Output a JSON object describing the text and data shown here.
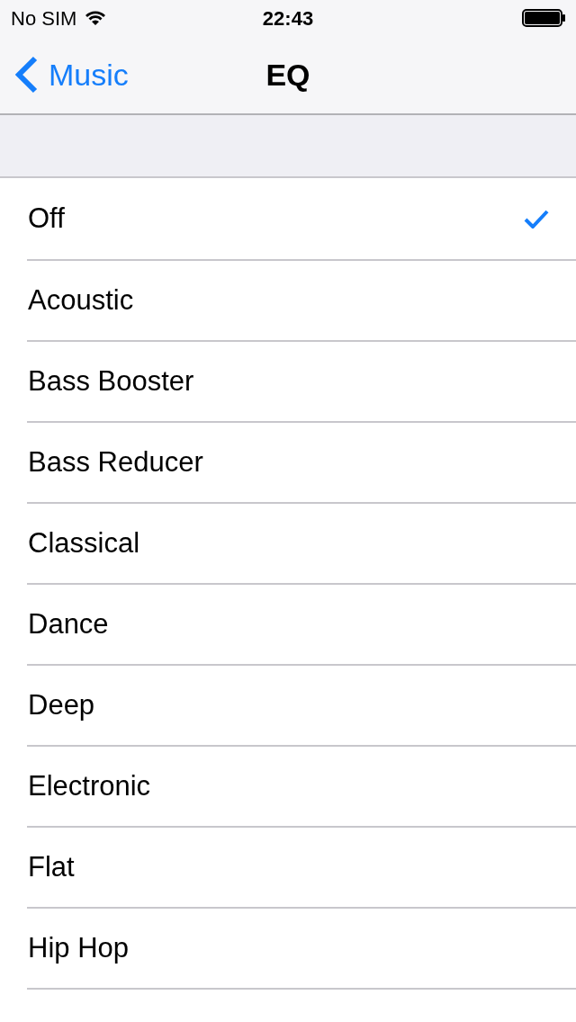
{
  "status_bar": {
    "carrier": "No SIM",
    "time": "22:43"
  },
  "nav": {
    "back": "Music",
    "title": "EQ"
  },
  "presets": [
    {
      "label": "Off",
      "selected": true
    },
    {
      "label": "Acoustic",
      "selected": false
    },
    {
      "label": "Bass Booster",
      "selected": false
    },
    {
      "label": "Bass Reducer",
      "selected": false
    },
    {
      "label": "Classical",
      "selected": false
    },
    {
      "label": "Dance",
      "selected": false
    },
    {
      "label": "Deep",
      "selected": false
    },
    {
      "label": "Electronic",
      "selected": false
    },
    {
      "label": "Flat",
      "selected": false
    },
    {
      "label": "Hip Hop",
      "selected": false
    }
  ]
}
